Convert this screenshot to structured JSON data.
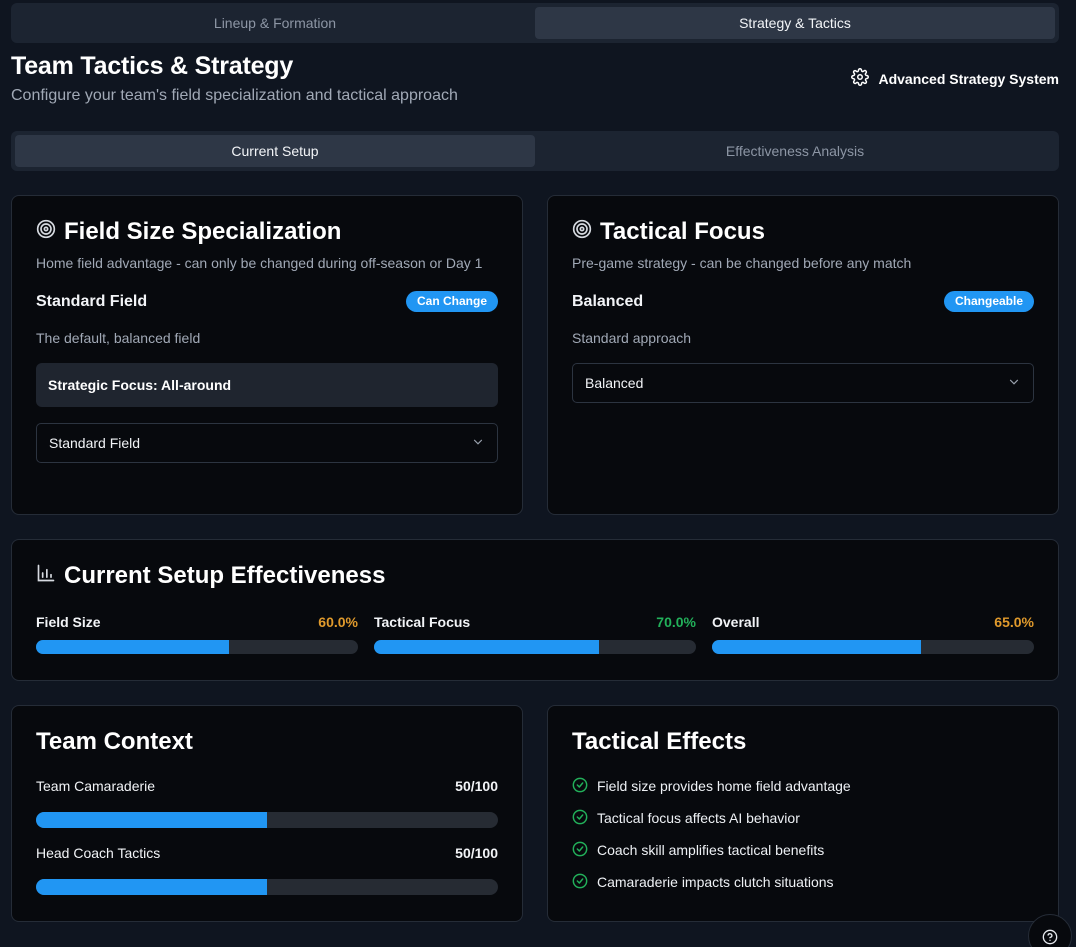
{
  "top_tabs": [
    {
      "label": "Lineup & Formation",
      "active": false
    },
    {
      "label": "Strategy & Tactics",
      "active": true
    }
  ],
  "header": {
    "title": "Team Tactics & Strategy",
    "subtitle": "Configure your team's field specialization and tactical approach",
    "advanced_label": "Advanced Strategy System"
  },
  "sub_tabs": [
    {
      "label": "Current Setup",
      "active": true
    },
    {
      "label": "Effectiveness Analysis",
      "active": false
    }
  ],
  "field_size": {
    "title": "Field Size Specialization",
    "description": "Home field advantage - can only be changed during off-season or Day 1",
    "current": "Standard Field",
    "badge": "Can Change",
    "current_desc": "The default, balanced field",
    "strategic_focus": "Strategic Focus: All-around",
    "select_value": "Standard Field"
  },
  "tactical_focus": {
    "title": "Tactical Focus",
    "description": "Pre-game strategy - can be changed before any match",
    "current": "Balanced",
    "badge": "Changeable",
    "current_desc": "Standard approach",
    "select_value": "Balanced"
  },
  "effectiveness": {
    "title": "Current Setup Effectiveness",
    "metrics": [
      {
        "label": "Field Size",
        "value_text": "60.0%",
        "value": 60,
        "color": "#e09a2c"
      },
      {
        "label": "Tactical Focus",
        "value_text": "70.0%",
        "value": 70,
        "color": "#22b05a"
      },
      {
        "label": "Overall",
        "value_text": "65.0%",
        "value": 65,
        "color": "#e09a2c"
      }
    ]
  },
  "team_context": {
    "title": "Team Context",
    "items": [
      {
        "label": "Team Camaraderie",
        "value_text": "50/100",
        "value": 50
      },
      {
        "label": "Head Coach Tactics",
        "value_text": "50/100",
        "value": 50
      }
    ]
  },
  "tactical_effects": {
    "title": "Tactical Effects",
    "items": [
      "Field size provides home field advantage",
      "Tactical focus affects AI behavior",
      "Coach skill amplifies tactical benefits",
      "Camaraderie impacts clutch situations"
    ]
  },
  "colors": {
    "accent": "#2196f3",
    "success": "#22b05a",
    "warning": "#e09a2c"
  }
}
